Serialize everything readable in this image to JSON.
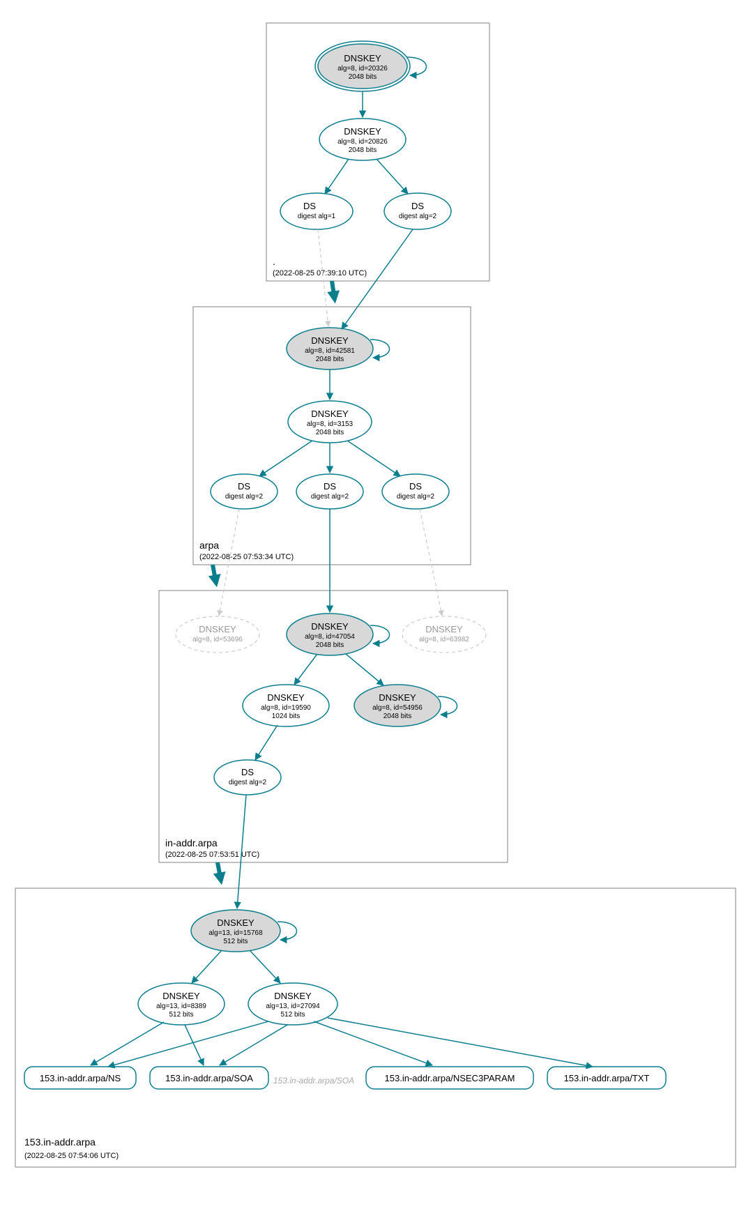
{
  "colors": {
    "teal": "#0a7e8c",
    "grey_fill": "#d8d8d8",
    "dim": "#cccccc"
  },
  "zones": {
    "root": {
      "label": ".",
      "time": "(2022-08-25 07:39:10 UTC)"
    },
    "arpa": {
      "label": "arpa",
      "time": "(2022-08-25 07:53:34 UTC)"
    },
    "inaddr": {
      "label": "in-addr.arpa",
      "time": "(2022-08-25 07:53:51 UTC)"
    },
    "leaf": {
      "label": "153.in-addr.arpa",
      "time": "(2022-08-25 07:54:06 UTC)"
    }
  },
  "nodes": {
    "root_ksk": {
      "title": "DNSKEY",
      "l1": "alg=8, id=20326",
      "l2": "2048 bits"
    },
    "root_zsk": {
      "title": "DNSKEY",
      "l1": "alg=8, id=20826",
      "l2": "2048 bits"
    },
    "root_ds1": {
      "title": "DS",
      "l1": "digest alg=1",
      "warn": true
    },
    "root_ds2": {
      "title": "DS",
      "l1": "digest alg=2"
    },
    "arpa_ksk": {
      "title": "DNSKEY",
      "l1": "alg=8, id=42581",
      "l2": "2048 bits"
    },
    "arpa_zsk": {
      "title": "DNSKEY",
      "l1": "alg=8, id=3153",
      "l2": "2048 bits"
    },
    "arpa_ds_l": {
      "title": "DS",
      "l1": "digest alg=2"
    },
    "arpa_ds_c": {
      "title": "DS",
      "l1": "digest alg=2"
    },
    "arpa_ds_r": {
      "title": "DS",
      "l1": "digest alg=2"
    },
    "in_dim_l": {
      "title": "DNSKEY",
      "l1": "alg=8, id=53696"
    },
    "in_ksk": {
      "title": "DNSKEY",
      "l1": "alg=8, id=47054",
      "l2": "2048 bits"
    },
    "in_dim_r": {
      "title": "DNSKEY",
      "l1": "alg=8, id=63982"
    },
    "in_zsk": {
      "title": "DNSKEY",
      "l1": "alg=8, id=19590",
      "l2": "1024 bits"
    },
    "in_grey2": {
      "title": "DNSKEY",
      "l1": "alg=8, id=54956",
      "l2": "2048 bits"
    },
    "in_ds": {
      "title": "DS",
      "l1": "digest alg=2"
    },
    "l_ksk": {
      "title": "DNSKEY",
      "l1": "alg=13, id=15768",
      "l2": "512 bits"
    },
    "l_zsk1": {
      "title": "DNSKEY",
      "l1": "alg=13, id=8389",
      "l2": "512 bits"
    },
    "l_zsk2": {
      "title": "DNSKEY",
      "l1": "alg=13, id=27094",
      "l2": "512 bits"
    }
  },
  "rrsets": {
    "ns": {
      "label": "153.in-addr.arpa/NS"
    },
    "soa": {
      "label": "153.in-addr.arpa/SOA"
    },
    "soa_err": {
      "label": "153.in-addr.arpa/SOA"
    },
    "nsec3": {
      "label": "153.in-addr.arpa/NSEC3PARAM"
    },
    "txt": {
      "label": "153.in-addr.arpa/TXT"
    }
  },
  "icons": {
    "warn_yellow_alt": "warning",
    "warn_red_alt": "error"
  }
}
